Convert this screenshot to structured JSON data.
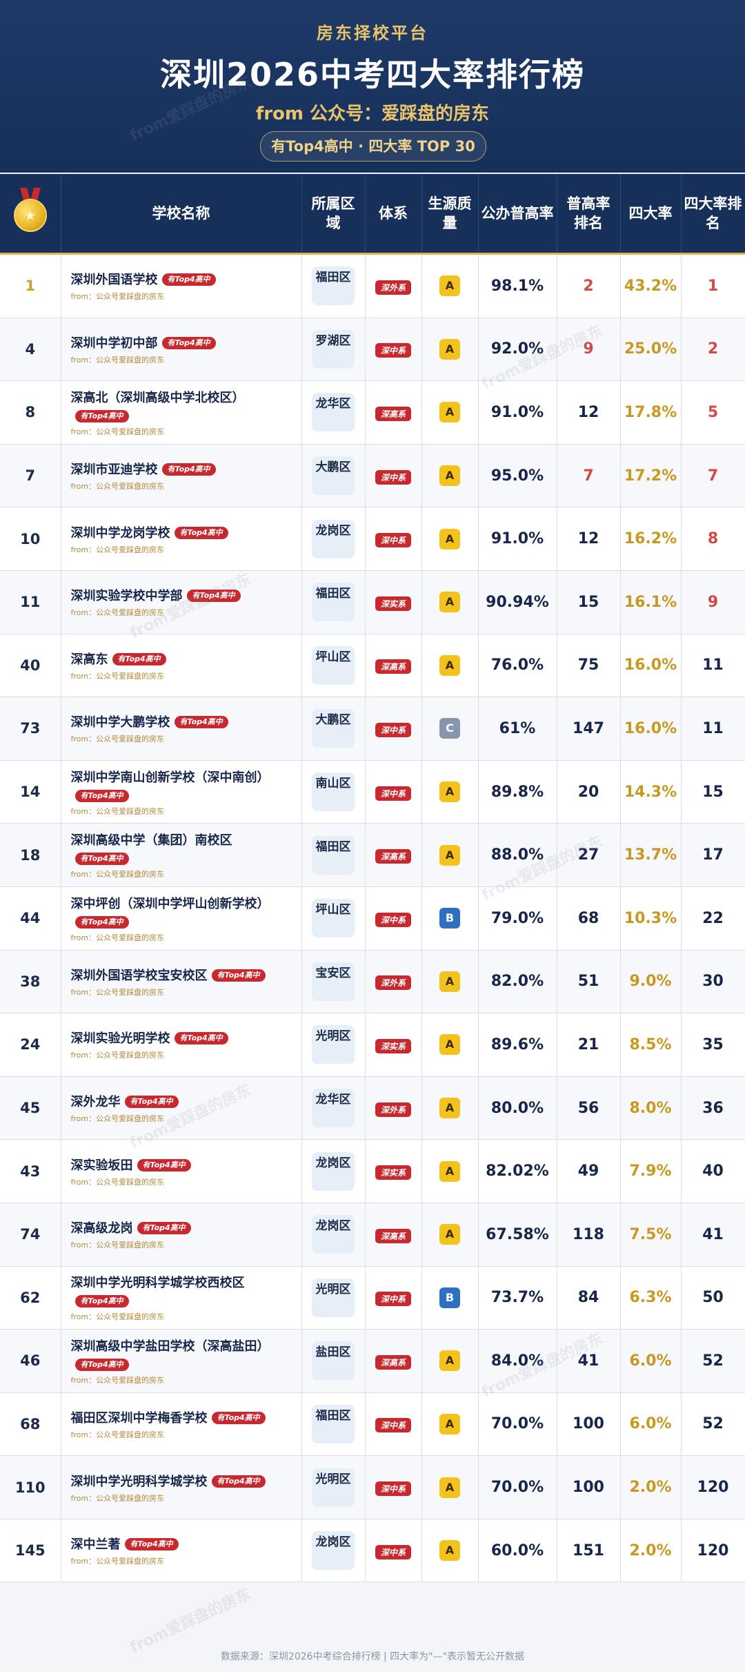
{
  "header": {
    "platform": "房东择校平台",
    "title": "深圳2026中考四大率排行榜",
    "from": "from 公众号：爱踩盘的房东",
    "pill": "有Top4高中 · 四大率 TOP 30"
  },
  "columns": {
    "name": "学校名称",
    "district": "所属区域",
    "system": "体系",
    "quality": "生源质量",
    "public_rate": "公办普高率",
    "public_rank": "普高率排名",
    "four_rate": "四大率",
    "four_rank": "四大率排名"
  },
  "medal_icon": "gold-medal-icon",
  "source_text": "from：公众号爱踩盘的房东",
  "watermark": "from爱踩盘的房东",
  "rows": [
    {
      "rank": "1",
      "name": "深圳外国语学校",
      "tag": "有Top4高中",
      "district": "福田区",
      "system": "深外系",
      "quality": "A",
      "public_rate": "98.1%",
      "public_rank": "2",
      "four_rate": "43.2%",
      "four_rank": "1"
    },
    {
      "rank": "4",
      "name": "深圳中学初中部",
      "tag": "有Top4高中",
      "district": "罗湖区",
      "system": "深中系",
      "quality": "A",
      "public_rate": "92.0%",
      "public_rank": "9",
      "four_rate": "25.0%",
      "four_rank": "2"
    },
    {
      "rank": "8",
      "name": "深高北（深圳高级中学北校区）",
      "tag": "有Top4高中",
      "district": "龙华区",
      "system": "深高系",
      "quality": "A",
      "public_rate": "91.0%",
      "public_rank": "12",
      "four_rate": "17.8%",
      "four_rank": "5"
    },
    {
      "rank": "7",
      "name": "深圳市亚迪学校",
      "tag": "有Top4高中",
      "district": "大鹏区",
      "system": "深中系",
      "quality": "A",
      "public_rate": "95.0%",
      "public_rank": "7",
      "four_rate": "17.2%",
      "four_rank": "7"
    },
    {
      "rank": "10",
      "name": "深圳中学龙岗学校",
      "tag": "有Top4高中",
      "district": "龙岗区",
      "system": "深中系",
      "quality": "A",
      "public_rate": "91.0%",
      "public_rank": "12",
      "four_rate": "16.2%",
      "four_rank": "8"
    },
    {
      "rank": "11",
      "name": "深圳实验学校中学部",
      "tag": "有Top4高中",
      "district": "福田区",
      "system": "深实系",
      "quality": "A",
      "public_rate": "90.94%",
      "public_rank": "15",
      "four_rate": "16.1%",
      "four_rank": "9"
    },
    {
      "rank": "40",
      "name": "深高东",
      "tag": "有Top4高中",
      "district": "坪山区",
      "system": "深高系",
      "quality": "A",
      "public_rate": "76.0%",
      "public_rank": "75",
      "four_rate": "16.0%",
      "four_rank": "11"
    },
    {
      "rank": "73",
      "name": "深圳中学大鹏学校",
      "tag": "有Top4高中",
      "district": "大鹏区",
      "system": "深中系",
      "quality": "C",
      "public_rate": "61%",
      "public_rank": "147",
      "four_rate": "16.0%",
      "four_rank": "11"
    },
    {
      "rank": "14",
      "name": "深圳中学南山创新学校（深中南创）",
      "tag": "有Top4高中",
      "district": "南山区",
      "system": "深中系",
      "quality": "A",
      "public_rate": "89.8%",
      "public_rank": "20",
      "four_rate": "14.3%",
      "four_rank": "15"
    },
    {
      "rank": "18",
      "name": "深圳高级中学（集团）南校区",
      "tag": "有Top4高中",
      "district": "福田区",
      "system": "深高系",
      "quality": "A",
      "public_rate": "88.0%",
      "public_rank": "27",
      "four_rate": "13.7%",
      "four_rank": "17"
    },
    {
      "rank": "44",
      "name": "深中坪创（深圳中学坪山创新学校）",
      "tag": "有Top4高中",
      "district": "坪山区",
      "system": "深中系",
      "quality": "B",
      "public_rate": "79.0%",
      "public_rank": "68",
      "four_rate": "10.3%",
      "four_rank": "22"
    },
    {
      "rank": "38",
      "name": "深圳外国语学校宝安校区",
      "tag": "有Top4高中",
      "district": "宝安区",
      "system": "深外系",
      "quality": "A",
      "public_rate": "82.0%",
      "public_rank": "51",
      "four_rate": "9.0%",
      "four_rank": "30"
    },
    {
      "rank": "24",
      "name": "深圳实验光明学校",
      "tag": "有Top4高中",
      "district": "光明区",
      "system": "深实系",
      "quality": "A",
      "public_rate": "89.6%",
      "public_rank": "21",
      "four_rate": "8.5%",
      "four_rank": "35"
    },
    {
      "rank": "45",
      "name": "深外龙华",
      "tag": "有Top4高中",
      "district": "龙华区",
      "system": "深外系",
      "quality": "A",
      "public_rate": "80.0%",
      "public_rank": "56",
      "four_rate": "8.0%",
      "four_rank": "36"
    },
    {
      "rank": "43",
      "name": "深实验坂田",
      "tag": "有Top4高中",
      "district": "龙岗区",
      "system": "深实系",
      "quality": "A",
      "public_rate": "82.02%",
      "public_rank": "49",
      "four_rate": "7.9%",
      "four_rank": "40"
    },
    {
      "rank": "74",
      "name": "深高级龙岗",
      "tag": "有Top4高中",
      "district": "龙岗区",
      "system": "深高系",
      "quality": "A",
      "public_rate": "67.58%",
      "public_rank": "118",
      "four_rate": "7.5%",
      "four_rank": "41"
    },
    {
      "rank": "62",
      "name": "深圳中学光明科学城学校西校区",
      "tag": "有Top4高中",
      "district": "光明区",
      "system": "深中系",
      "quality": "B",
      "public_rate": "73.7%",
      "public_rank": "84",
      "four_rate": "6.3%",
      "four_rank": "50"
    },
    {
      "rank": "46",
      "name": "深圳高级中学盐田学校（深高盐田）",
      "tag": "有Top4高中",
      "district": "盐田区",
      "system": "深高系",
      "quality": "A",
      "public_rate": "84.0%",
      "public_rank": "41",
      "four_rate": "6.0%",
      "four_rank": "52"
    },
    {
      "rank": "68",
      "name": "福田区深圳中学梅香学校",
      "tag": "有Top4高中",
      "district": "福田区",
      "system": "深中系",
      "quality": "A",
      "public_rate": "70.0%",
      "public_rank": "100",
      "four_rate": "6.0%",
      "four_rank": "52"
    },
    {
      "rank": "110",
      "name": "深圳中学光明科学城学校",
      "tag": "有Top4高中",
      "district": "光明区",
      "system": "深中系",
      "quality": "A",
      "public_rate": "70.0%",
      "public_rank": "100",
      "four_rate": "2.0%",
      "four_rank": "120"
    },
    {
      "rank": "145",
      "name": "深中兰著",
      "tag": "有Top4高中",
      "district": "龙岗区",
      "system": "深中系",
      "quality": "A",
      "public_rate": "60.0%",
      "public_rank": "151",
      "four_rate": "2.0%",
      "four_rank": "120"
    }
  ],
  "footer": "数据来源：深圳2026中考综合排行榜 | 四大率为\"—\"表示暂无公开数据"
}
